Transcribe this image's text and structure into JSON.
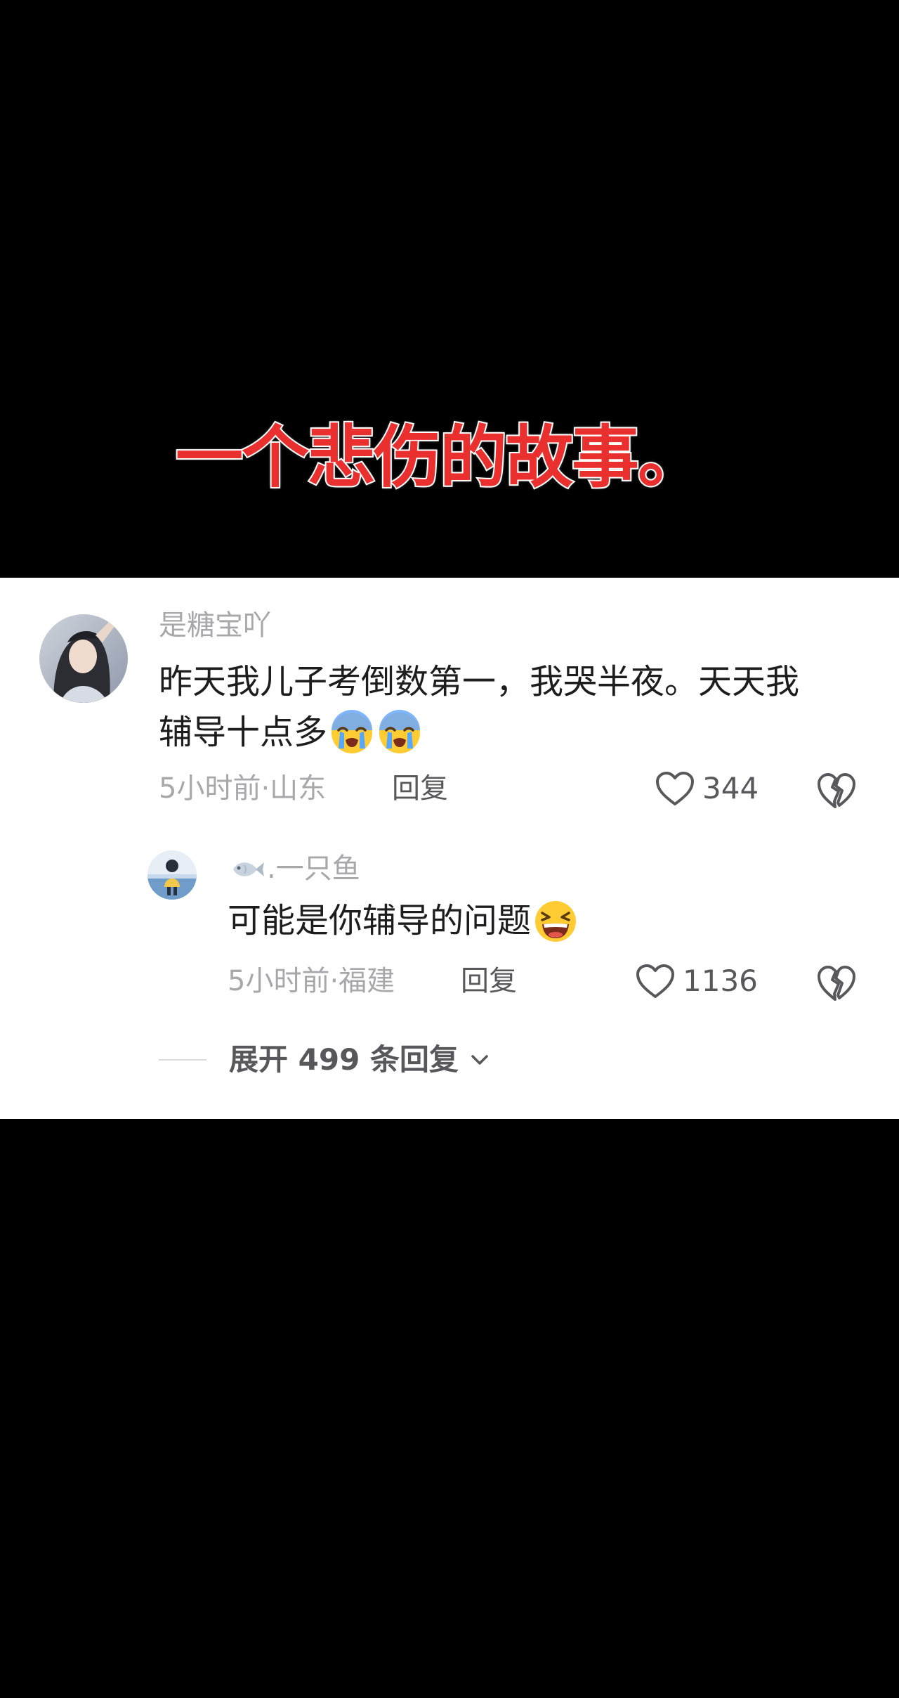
{
  "banner": {
    "title": "一个悲伤的故事。",
    "title_color": "#ea2f2f"
  },
  "comments": [
    {
      "username": "是糖宝吖",
      "avatar": "girl-portrait-avatar",
      "text_line_1": "昨天我儿子考倒数第一，我哭半夜。天天我",
      "text_line_2": "辅导十点多",
      "emojis": [
        "crying-face-emoji",
        "crying-face-emoji"
      ],
      "meta": "5小时前·山东",
      "reply_label": "回复",
      "likes": "344",
      "like_icon": "heart-outline-icon",
      "dislike_icon": "broken-heart-icon",
      "replies": [
        {
          "username": ".一只鱼",
          "username_icon": "fish-icon",
          "avatar": "beach-figure-avatar",
          "text": "可能是你辅导的问题",
          "emoji": "laughing-squint-emoji",
          "meta": "5小时前·福建",
          "reply_label": "回复",
          "likes": "1136",
          "like_icon": "heart-outline-icon",
          "dislike_icon": "broken-heart-icon"
        }
      ],
      "expand_label": "展开 499 条回复",
      "expand_icon": "chevron-down-icon"
    }
  ],
  "colors": {
    "background": "#000000",
    "card": "#ffffff",
    "text_primary": "#1d1d1f",
    "text_secondary": "#a8a8ac",
    "text_action": "#58585c"
  }
}
